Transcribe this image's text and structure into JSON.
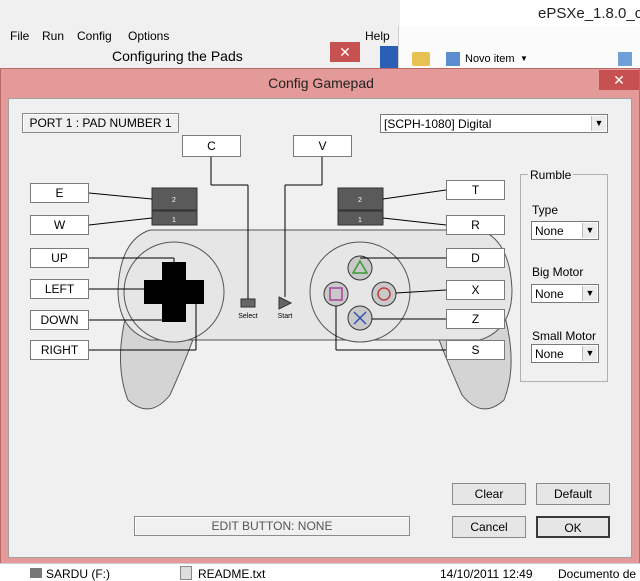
{
  "background_app": {
    "title": "ePSXe_1.8.0_c",
    "menu": [
      "File",
      "Run",
      "Config",
      "Options"
    ],
    "help": "Help",
    "subwindow_title": "Configuring the Pads",
    "toolbar_item": "Novo item"
  },
  "dialog": {
    "title": "Config Gamepad",
    "port_button": "PORT 1 : PAD NUMBER 1",
    "pad_type": "[SCPH-1080] Digital",
    "keys": {
      "l2": "E",
      "l1": "W",
      "up": "UP",
      "left": "LEFT",
      "down": "DOWN",
      "right": "RIGHT",
      "select": "C",
      "start": "V",
      "r2": "T",
      "r1": "R",
      "triangle": "D",
      "circle": "X",
      "cross": "Z",
      "square": "S"
    },
    "pad_labels": {
      "select": "Select",
      "start": "Start",
      "l2": "2",
      "l1": "1",
      "r2": "2",
      "r1": "1"
    },
    "rumble": {
      "title": "Rumble",
      "type_label": "Type",
      "type_value": "None",
      "big_label": "Big Motor",
      "big_value": "None",
      "small_label": "Small Motor",
      "small_value": "None"
    },
    "edit_status": "EDIT BUTTON: NONE",
    "buttons": {
      "clear": "Clear",
      "default": "Default",
      "cancel": "Cancel",
      "ok": "OK"
    }
  },
  "status_bar": {
    "drive": "SARDU (F:)",
    "file": "README.txt",
    "date": "14/10/2011 12:49",
    "type": "Documento de"
  }
}
